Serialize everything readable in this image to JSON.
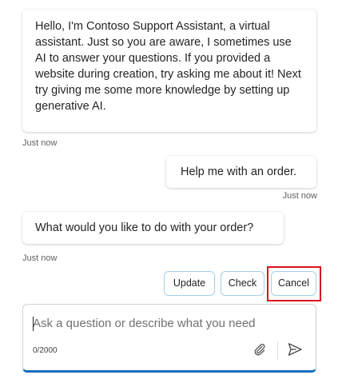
{
  "chat": {
    "bot_message_1": {
      "text": "Hello, I'm Contoso Support Assistant, a virtual assistant. Just so you are aware, I sometimes use AI to answer your questions. If you provided a website during creation, try asking me about it! Next try giving me some more knowledge by setting up generative AI.",
      "timestamp": "Just now"
    },
    "user_message_1": {
      "text": "Help me with an order.",
      "timestamp": "Just now"
    },
    "bot_message_2": {
      "text": "What would you like to do with your order?",
      "timestamp": "Just now"
    },
    "suggested_actions": [
      {
        "label": "Update"
      },
      {
        "label": "Check"
      },
      {
        "label": "Cancel"
      }
    ]
  },
  "composer": {
    "placeholder": "Ask a question or describe what you need",
    "char_count": "0/2000",
    "attach_icon": "paperclip-icon",
    "send_icon": "send-icon",
    "accent_color": "#0f6cbd"
  },
  "annotation": {
    "highlight_color": "#d9121b"
  }
}
